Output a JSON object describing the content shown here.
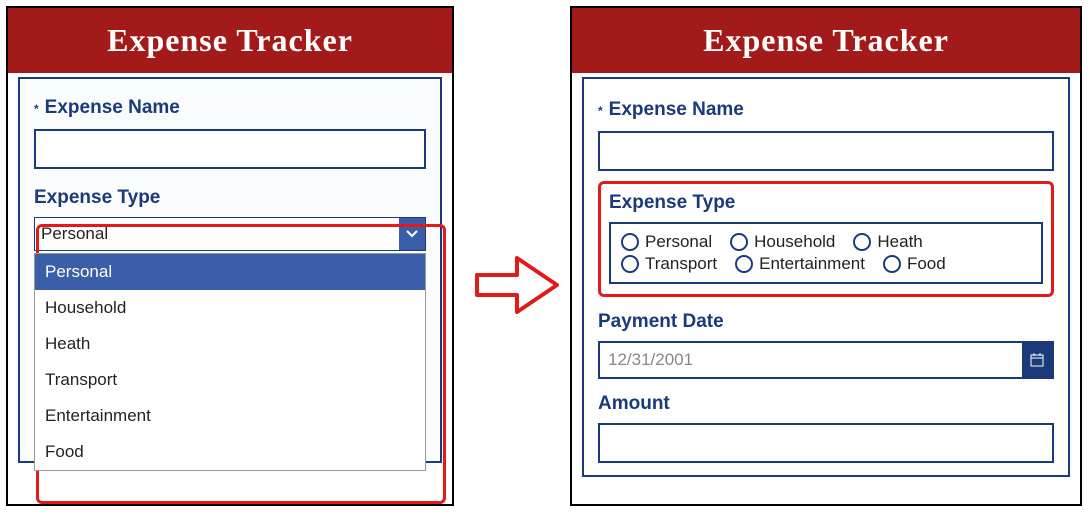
{
  "app": {
    "title": "Expense Tracker"
  },
  "left": {
    "fields": {
      "expense_name_label": "Expense Name",
      "expense_name_value": "",
      "expense_type_label": "Expense Type"
    },
    "dropdown": {
      "selected": "Personal",
      "options": [
        "Personal",
        "Household",
        "Heath",
        "Transport",
        "Entertainment",
        "Food"
      ]
    }
  },
  "right": {
    "fields": {
      "expense_name_label": "Expense Name",
      "expense_name_value": "",
      "expense_type_label": "Expense Type",
      "payment_date_label": "Payment Date",
      "payment_date_value": "12/31/2001",
      "amount_label": "Amount",
      "amount_value": ""
    },
    "radios": [
      "Personal",
      "Household",
      "Heath",
      "Transport",
      "Entertainment",
      "Food"
    ]
  }
}
